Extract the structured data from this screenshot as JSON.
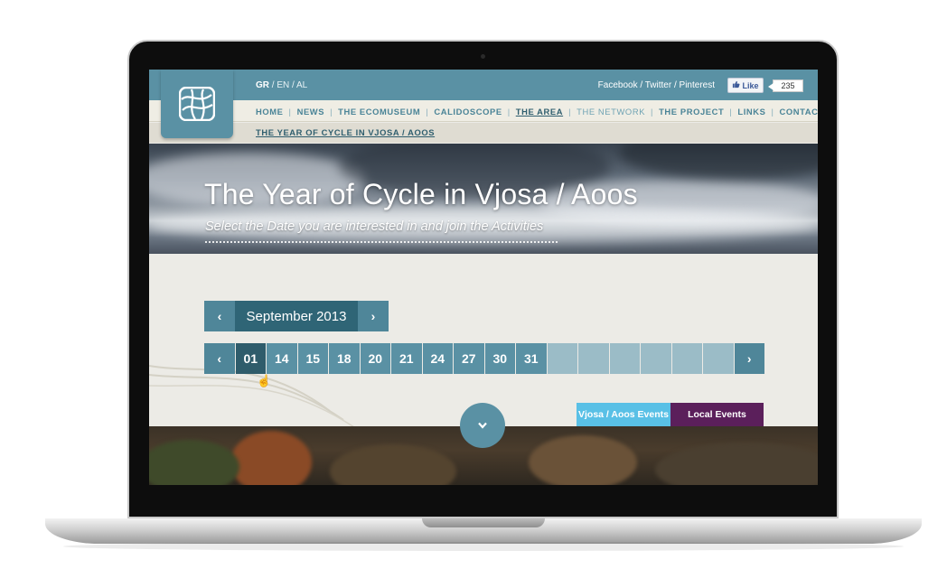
{
  "header": {
    "languages": {
      "active": "GR",
      "rest": " / EN / AL"
    },
    "social": {
      "facebook": "Facebook",
      "twitter": "Twitter",
      "pinterest": "Pinterest",
      "sep": " / "
    },
    "like": {
      "label": "Like",
      "count": "235"
    }
  },
  "nav": {
    "items": [
      {
        "label": "HOME"
      },
      {
        "label": "NEWS"
      },
      {
        "label": "THE ECOMUSEUM"
      },
      {
        "label": "CALIDOSCOPE"
      },
      {
        "label": "THE AREA"
      },
      {
        "label": "THE NETWORK"
      },
      {
        "label": "THE PROJECT"
      },
      {
        "label": "LINKS"
      },
      {
        "label": "CONTACT"
      }
    ],
    "sub": "THE YEAR OF CYCLE IN VJOSA / AOOS"
  },
  "hero": {
    "title": "The Year of Cycle in Vjosa / Aoos",
    "subtitle": "Select the Date you are interested in and join the Activities"
  },
  "calendar": {
    "month": "September 2013",
    "days": [
      "01",
      "14",
      "15",
      "18",
      "20",
      "21",
      "24",
      "27",
      "30",
      "31"
    ],
    "selected": "01",
    "empty_slots": 6
  },
  "events": {
    "vjosa": "Vjosa / Aoos Events",
    "local": "Local Events"
  },
  "colors": {
    "brand": "#5a91a4",
    "dark": "#2f5c6b",
    "vjosa_events": "#59c0e6",
    "local_events": "#5b1f5b"
  },
  "icons": {
    "prev": "chevron-left-icon",
    "next": "chevron-right-icon",
    "scroll": "chevron-down-icon",
    "like": "thumbs-up-icon",
    "logo": "ecomuseum-logo"
  }
}
